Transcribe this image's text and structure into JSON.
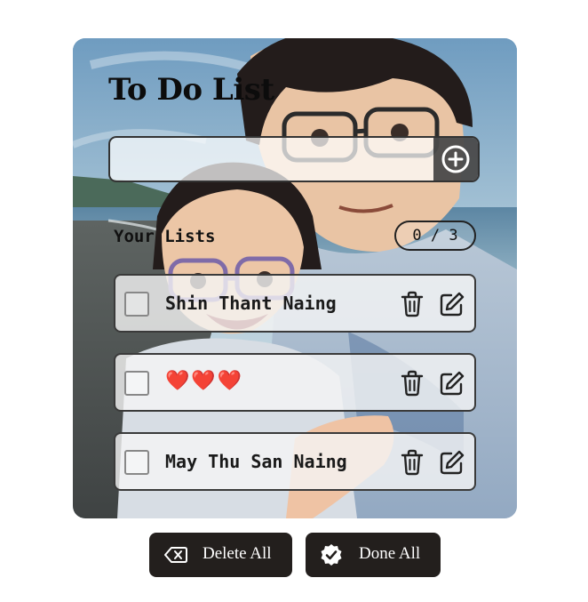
{
  "app": {
    "title": "To Do List"
  },
  "input": {
    "value": "",
    "placeholder": "",
    "add_icon": "plus-circle-icon"
  },
  "lists": {
    "label": "Your Lists",
    "counter": "0 / 3",
    "items": [
      {
        "text": "Shin Thant Naing",
        "checked": false
      },
      {
        "text": "❤️❤️❤️",
        "checked": false
      },
      {
        "text": "May Thu San Naing",
        "checked": false
      }
    ]
  },
  "actions": {
    "delete_all": "Delete All",
    "done_all": "Done All"
  },
  "colors": {
    "button_bg": "#231f1d",
    "button_text": "#ffffff",
    "item_bg": "#f5f5f5",
    "heart": "#e0363c"
  }
}
